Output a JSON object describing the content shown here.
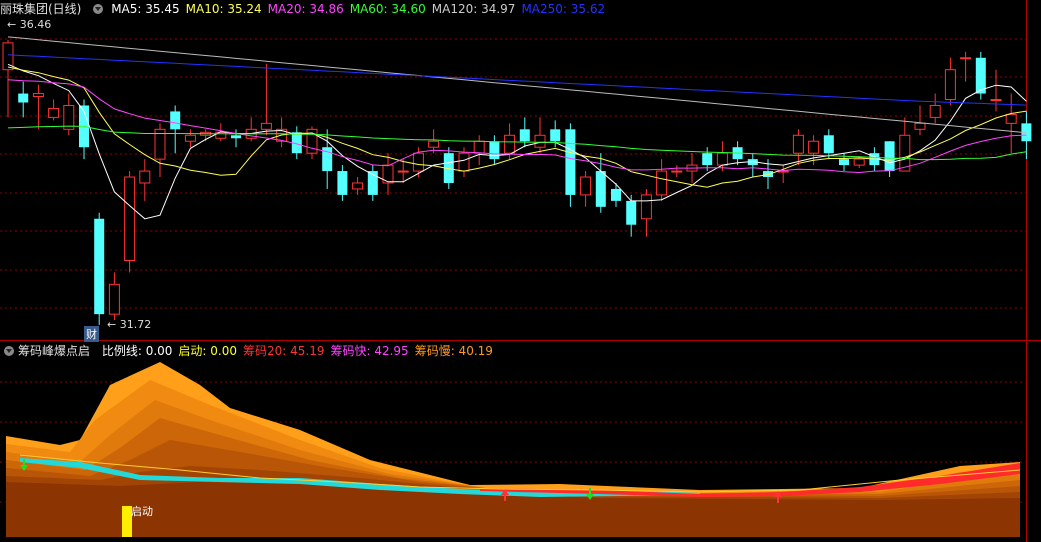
{
  "main_legend": {
    "title": "丽珠集团(日线)",
    "items": [
      {
        "label": "MA5: 35.45",
        "color": "#ffffff"
      },
      {
        "label": "MA10: 35.24",
        "color": "#ffff55"
      },
      {
        "label": "MA20: 34.86",
        "color": "#ff44ff"
      },
      {
        "label": "MA60: 34.60",
        "color": "#33ff33"
      },
      {
        "label": "MA120: 34.97",
        "color": "#cccccc"
      },
      {
        "label": "MA250: 35.62",
        "color": "#2233ff"
      }
    ]
  },
  "sub_legend": {
    "title": "筹码峰爆点启",
    "items": [
      {
        "label": "比例线: 0.00",
        "color": "#ffffff"
      },
      {
        "label": "启动: 0.00",
        "color": "#ffff33"
      },
      {
        "label": "筹码20: 45.19",
        "color": "#ff3333"
      },
      {
        "label": "筹码快: 42.95",
        "color": "#ff44ff"
      },
      {
        "label": "筹码慢: 40.19",
        "color": "#ff9922"
      }
    ]
  },
  "annotations": {
    "high": "← 36.46",
    "low": "← 31.72",
    "fin_badge": "财",
    "start_label": "启动"
  },
  "colors": {
    "up": "#ff3333",
    "down": "#54ffff",
    "grid": "#8b0000",
    "frame": "#b00000"
  },
  "chart_data": {
    "type": "candlestick",
    "price_range": [
      31.5,
      36.8
    ],
    "candles": [
      [
        36.0,
        36.45,
        36.5,
        35.2
      ],
      [
        35.6,
        35.45,
        35.8,
        35.2
      ],
      [
        35.55,
        35.6,
        35.75,
        35.0
      ],
      [
        35.2,
        35.35,
        35.5,
        35.15
      ],
      [
        35.0,
        35.4,
        35.6,
        34.9
      ],
      [
        35.4,
        34.7,
        35.5,
        34.5
      ],
      [
        33.5,
        31.9,
        33.6,
        31.72
      ],
      [
        31.9,
        32.4,
        32.6,
        31.8
      ],
      [
        32.8,
        34.2,
        34.3,
        32.6
      ],
      [
        34.1,
        34.3,
        34.5,
        33.8
      ],
      [
        34.5,
        35.0,
        35.1,
        34.2
      ],
      [
        35.3,
        35.0,
        35.4,
        34.6
      ],
      [
        34.8,
        34.9,
        35.0,
        34.7
      ],
      [
        34.9,
        34.95,
        35.0,
        34.8
      ],
      [
        34.85,
        34.95,
        35.1,
        34.8
      ],
      [
        34.9,
        34.85,
        35.0,
        34.7
      ],
      [
        34.85,
        35.0,
        35.2,
        34.8
      ],
      [
        35.0,
        35.1,
        36.1,
        34.9
      ],
      [
        34.8,
        35.0,
        35.2,
        34.7
      ],
      [
        34.95,
        34.6,
        35.05,
        34.5
      ],
      [
        34.6,
        35.0,
        35.05,
        34.5
      ],
      [
        34.7,
        34.3,
        35.0,
        34.0
      ],
      [
        34.3,
        33.9,
        34.4,
        33.8
      ],
      [
        34.0,
        34.1,
        34.2,
        33.9
      ],
      [
        34.3,
        33.9,
        34.4,
        33.8
      ],
      [
        34.1,
        34.4,
        34.6,
        33.9
      ],
      [
        34.3,
        34.3,
        34.5,
        34.1
      ],
      [
        34.3,
        34.6,
        34.7,
        34.2
      ],
      [
        34.7,
        34.8,
        35.0,
        34.6
      ],
      [
        34.6,
        34.1,
        34.7,
        34.0
      ],
      [
        34.3,
        34.6,
        34.7,
        34.2
      ],
      [
        34.6,
        34.8,
        34.9,
        34.4
      ],
      [
        34.8,
        34.5,
        34.9,
        34.4
      ],
      [
        34.6,
        34.9,
        35.1,
        34.5
      ],
      [
        35.0,
        34.8,
        35.2,
        34.7
      ],
      [
        34.7,
        34.9,
        35.2,
        34.6
      ],
      [
        35.0,
        34.8,
        35.15,
        34.7
      ],
      [
        35.0,
        33.9,
        35.1,
        33.7
      ],
      [
        33.9,
        34.2,
        34.3,
        33.7
      ],
      [
        34.3,
        33.7,
        34.6,
        33.6
      ],
      [
        34.0,
        33.8,
        34.1,
        33.7
      ],
      [
        33.8,
        33.4,
        33.9,
        33.2
      ],
      [
        33.5,
        33.9,
        34.0,
        33.2
      ],
      [
        33.9,
        34.3,
        34.5,
        33.8
      ],
      [
        34.3,
        34.3,
        34.4,
        34.2
      ],
      [
        34.3,
        34.4,
        34.6,
        34.1
      ],
      [
        34.6,
        34.4,
        34.7,
        34.3
      ],
      [
        34.4,
        34.6,
        34.8,
        34.3
      ],
      [
        34.7,
        34.5,
        34.8,
        34.4
      ],
      [
        34.5,
        34.4,
        34.6,
        34.2
      ],
      [
        34.3,
        34.2,
        34.5,
        34.0
      ],
      [
        34.3,
        34.3,
        34.4,
        34.1
      ],
      [
        34.6,
        34.9,
        35.0,
        34.4
      ],
      [
        34.6,
        34.8,
        34.9,
        34.4
      ],
      [
        34.9,
        34.6,
        35.0,
        34.5
      ],
      [
        34.5,
        34.4,
        34.6,
        34.3
      ],
      [
        34.4,
        34.5,
        34.55,
        34.35
      ],
      [
        34.6,
        34.4,
        34.7,
        34.3
      ],
      [
        34.8,
        34.3,
        34.8,
        34.2
      ],
      [
        34.3,
        34.9,
        35.2,
        34.3
      ],
      [
        35.0,
        35.1,
        35.4,
        34.9
      ],
      [
        35.2,
        35.4,
        35.6,
        35.1
      ],
      [
        35.5,
        36.0,
        36.2,
        35.4
      ],
      [
        36.2,
        36.2,
        36.3,
        35.8
      ],
      [
        36.2,
        35.6,
        36.3,
        35.5
      ],
      [
        35.5,
        35.5,
        36.0,
        35.3
      ],
      [
        35.1,
        35.25,
        35.6,
        34.6
      ],
      [
        35.1,
        34.8,
        35.3,
        34.5
      ]
    ],
    "chips": {
      "range": [
        0,
        100
      ]
    }
  }
}
